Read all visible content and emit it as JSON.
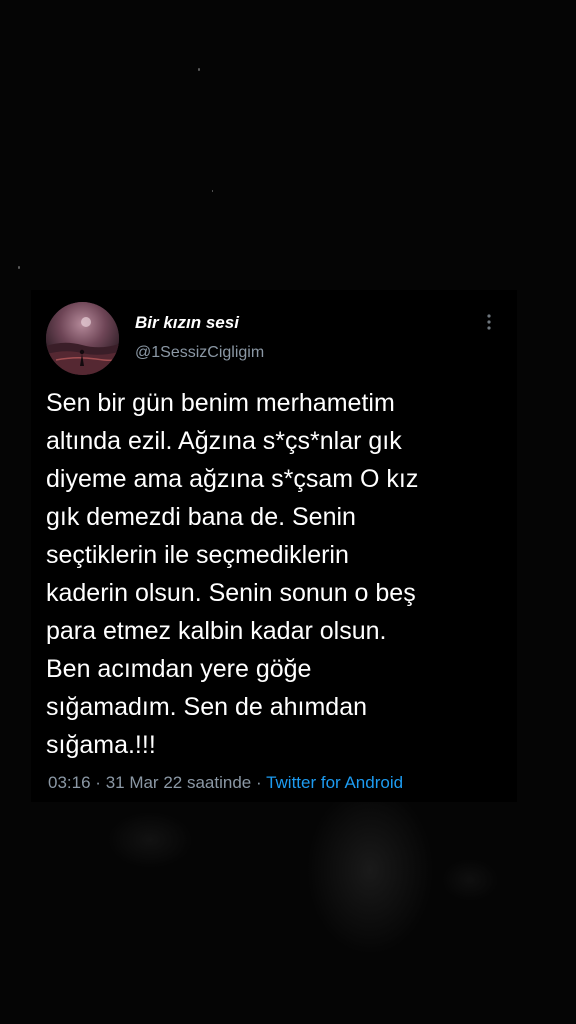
{
  "tweet": {
    "author": {
      "display_name": "Bir kızın sesi",
      "handle": "@1SessizCigligim"
    },
    "text_lines": [
      "Sen bir gün benim merhametim",
      "altında ezil. Ağzına s*çs*nlar gık",
      "diyeme ama ağzına s*çsam O kız",
      "gık demezdi bana de. Senin",
      "seçtiklerin ile seçmediklerin",
      "kaderin olsun. Senin sonun o beş",
      "para etmez kalbin kadar olsun.",
      "Ben acımdan yere göğe",
      "sığamadım. Sen de ahımdan",
      "sığama.!!!"
    ],
    "time": "03:16",
    "date": "31 Mar 22 saatinde",
    "separator": "·",
    "source": "Twitter for Android",
    "icons": {
      "more": "more-vertical-icon",
      "avatar": "avatar-image"
    },
    "colors": {
      "background": "#000000",
      "text": "#ffffff",
      "secondary": "#8b98a5",
      "link": "#1d9bf0"
    }
  }
}
